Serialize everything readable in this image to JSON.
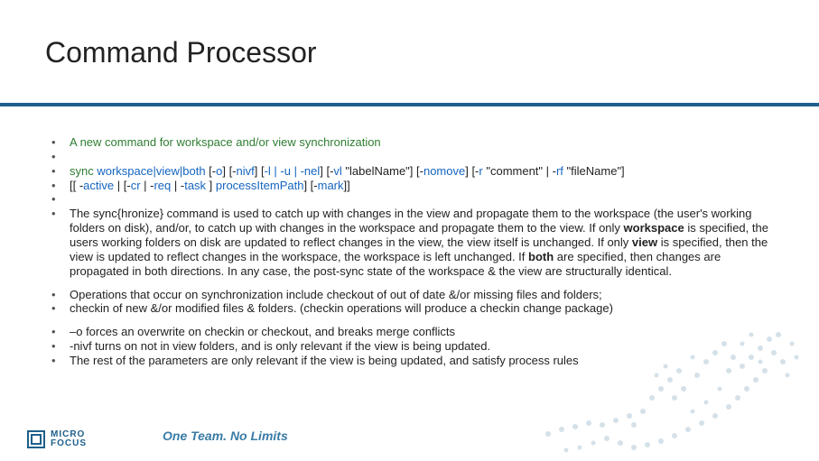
{
  "title": "Command Processor",
  "bullets": [
    {
      "kind": "green",
      "text": "A new command for workspace and/or view synchronization"
    },
    {
      "kind": "blank"
    },
    {
      "kind": "syntax"
    },
    {
      "kind": "syntax2"
    },
    {
      "kind": "blank"
    },
    {
      "kind": "sync_desc"
    },
    {
      "kind": "sep"
    },
    {
      "kind": "plain",
      "text": "Operations that occur on synchronization include checkout of out of date &/or missing files and folders;"
    },
    {
      "kind": "plain_cont",
      "text": "checkin of new &/or modified files & folders. (checkin operations will produce a checkin change package)"
    },
    {
      "kind": "sep"
    },
    {
      "kind": "plain",
      "text": "–o forces an overwrite on checkin or checkout, and breaks merge conflicts"
    },
    {
      "kind": "plain",
      "text": "-nivf turns on not in view folders, and is only relevant if the view is being updated."
    },
    {
      "kind": "plain",
      "text": "The rest of the parameters are only relevant if the view is being updated, and satisfy process rules"
    }
  ],
  "syntax": {
    "cmd": "sync ",
    "target": "workspace|view|both",
    "o1": " [-",
    "o": "o",
    "c1": "] [-",
    "nivf": "nivf",
    "c2": "] [",
    "lun": "-l | -u | -nel",
    "c3": "] [-",
    "vl": "vl",
    "lbl": " \"labelName\"] [-",
    "nomove": "nomove",
    "c4": "] [-",
    "r": "r",
    "com": " \"comment\" | -",
    "rf": "rf",
    "fname": " \"fileName\"]"
  },
  "syntax2": {
    "p1": "[[ -",
    "active": "active",
    "p2": " | [-",
    "cr": "cr",
    "p3": " | -",
    "req": "req",
    "p4": " | -",
    "task": "task",
    "p5": " ] ",
    "pip": "processItemPath",
    "p6": "] [-",
    "mark": "mark",
    "p7": "]]"
  },
  "sync_desc": {
    "pre": "The sync{hronize} command is used to catch up with changes in the view and propagate them to the workspace (the user's working folders on disk), and/or, to catch up with changes in the workspace and propagate them to the view. If only ",
    "ws": "workspace",
    "mid1": " is specified, the users working folders on disk are updated to reflect changes in the view, the view itself is unchanged. If only ",
    "vw": "view",
    "mid2": " is specified, then the view is updated to reflect changes in the workspace, the workspace is left unchanged. If ",
    "both": "both",
    "post": " are specified, then changes are propagated in both directions. In any case, the post-sync state of the workspace & the view are structurally identical."
  },
  "footer": {
    "brand1": "MICRO",
    "brand2": "FOCUS",
    "tagline": "One Team. No Limits"
  }
}
